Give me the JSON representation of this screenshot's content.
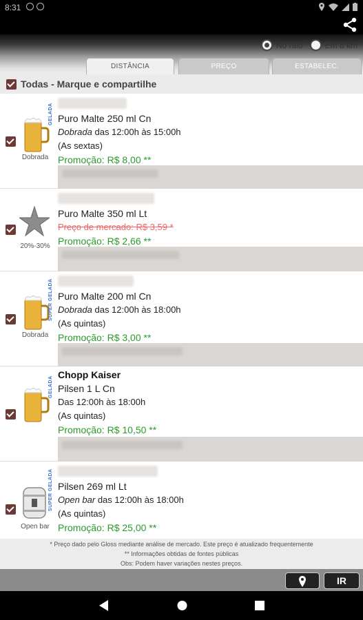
{
  "status": {
    "time": "8:31"
  },
  "filters": {
    "radio1": "No raio",
    "radio2": "Em 8 km",
    "tabs": [
      "DISTÂNCIA",
      "PREÇO",
      "ESTABELEC."
    ]
  },
  "all_label": "Todas - Marque e compartilhe",
  "items": [
    {
      "vtag": "GELADA",
      "tag": "Dobrada",
      "product": "Puro Malte 250 ml Cn",
      "sched_em": "Dobrada",
      "sched": " das 12:00h às 15:00h",
      "days": "(As sextas)",
      "promo": "Promoção: R$ 8,00  **"
    },
    {
      "tag": "20%-30%",
      "product": "Puro Malte 350 ml Lt",
      "market": "Preço de mercado: R$ 3,59 *",
      "promo": "Promoção: R$ 2,66  **"
    },
    {
      "vtag": "SUPER GELADA",
      "tag": "Dobrada",
      "product": "Puro Malte 200 ml Cn",
      "sched_em": "Dobrada",
      "sched": " das 12:00h às 18:00h",
      "days": "(As quintas)",
      "promo": "Promoção: R$ 3,00  **"
    },
    {
      "vtag": "GELADA",
      "title": "Chopp Kaiser",
      "product": "Pilsen 1 L Cn",
      "sched": "Das 12:00h às 18:00h",
      "days": "(As quintas)",
      "promo": "Promoção: R$ 10,50  **"
    },
    {
      "vtag": "SUPER GELADA",
      "tag": "Open bar",
      "product": "Pilsen 269 ml Lt",
      "sched_em": "Open bar",
      "sched": " das 12:00h às 18:00h",
      "days": "(As quintas)",
      "promo": "Promoção: R$ 25,00  **"
    }
  ],
  "footnotes": [
    "* Preço dado pelo Gloss mediante análise de mercado. Este preço é atualizado frequentemente",
    "** Informações obtidas de fontes públicas",
    "Obs: Podem haver variações nestes preços."
  ],
  "buttons": {
    "go": "IR"
  }
}
